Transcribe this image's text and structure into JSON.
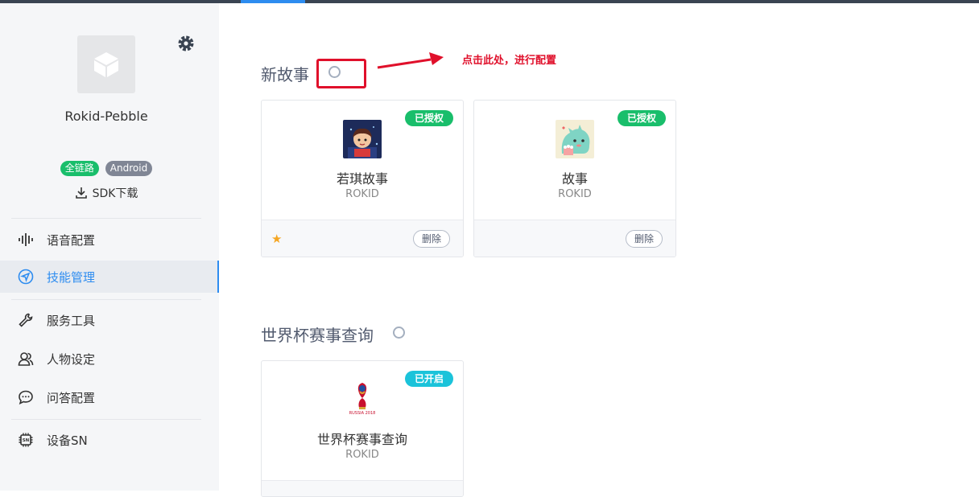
{
  "sidebar": {
    "device_name": "Rokid-Pebble",
    "badges": [
      "全链路",
      "Android"
    ],
    "sdk_download": "SDK下载",
    "items": [
      {
        "label": "语音配置"
      },
      {
        "label": "技能管理"
      },
      {
        "label": "服务工具"
      },
      {
        "label": "人物设定"
      },
      {
        "label": "问答配置"
      },
      {
        "label": "设备SN"
      }
    ]
  },
  "main": {
    "annotation": "点击此处，进行配置",
    "sections": [
      {
        "title": "新故事",
        "cards": [
          {
            "name": "若琪故事",
            "vendor": "ROKID",
            "status": "已授权",
            "delete_label": "删除"
          },
          {
            "name": "故事",
            "vendor": "ROKID",
            "status": "已授权",
            "delete_label": "删除"
          }
        ]
      },
      {
        "title": "世界杯赛事查询",
        "cards": [
          {
            "name": "世界杯赛事查询",
            "vendor": "ROKID",
            "status": "已开启",
            "logo_text": "RUSSIA 2018"
          }
        ]
      }
    ]
  },
  "colors": {
    "accent": "#2d8cf0",
    "authorized": "#19be6b",
    "enabled": "#1bc3da",
    "annotation": "#e0102b"
  }
}
